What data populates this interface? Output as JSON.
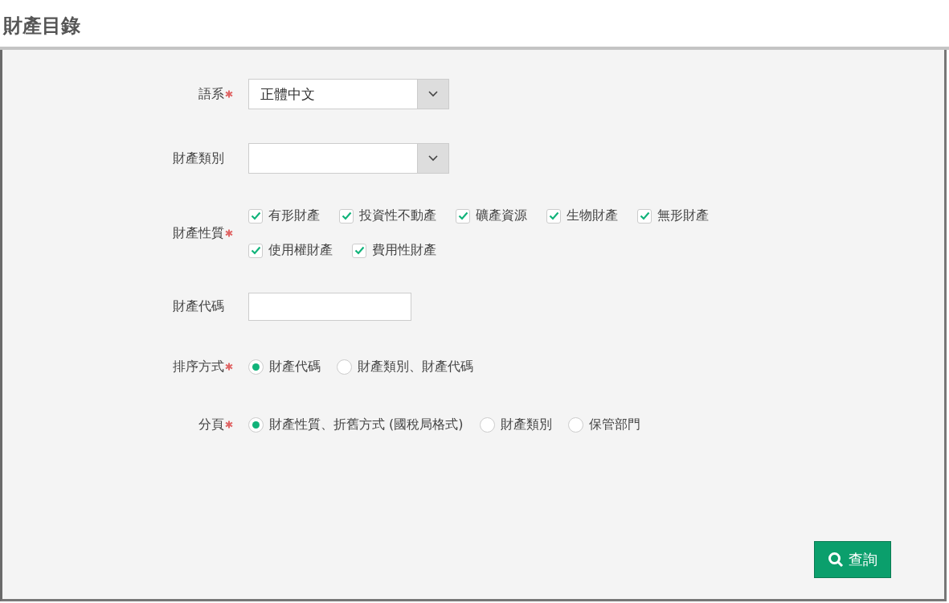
{
  "page": {
    "title": "財產目錄"
  },
  "form": {
    "language": {
      "label": "語系",
      "required": true,
      "value": "正體中文"
    },
    "category": {
      "label": "財產類別",
      "required": false
    },
    "nature": {
      "label": "財產性質",
      "required": true,
      "options": [
        {
          "label": "有形財產",
          "checked": true
        },
        {
          "label": "投資性不動產",
          "checked": true
        },
        {
          "label": "礦產資源",
          "checked": true
        },
        {
          "label": "生物財產",
          "checked": true
        },
        {
          "label": "無形財產",
          "checked": true
        },
        {
          "label": "使用權財產",
          "checked": true
        },
        {
          "label": "費用性財產",
          "checked": true
        }
      ]
    },
    "code": {
      "label": "財產代碼",
      "required": false
    },
    "sort": {
      "label": "排序方式",
      "required": true,
      "options": [
        {
          "label": "財產代碼",
          "selected": true
        },
        {
          "label": "財產類別、財產代碼",
          "selected": false
        }
      ]
    },
    "paging": {
      "label": "分頁",
      "required": true,
      "options": [
        {
          "label": "財產性質、折舊方式 (國稅局格式)",
          "selected": true
        },
        {
          "label": "財產類別",
          "selected": false
        },
        {
          "label": "保管部門",
          "selected": false
        }
      ]
    }
  },
  "search_button": {
    "label": "查詢"
  }
}
